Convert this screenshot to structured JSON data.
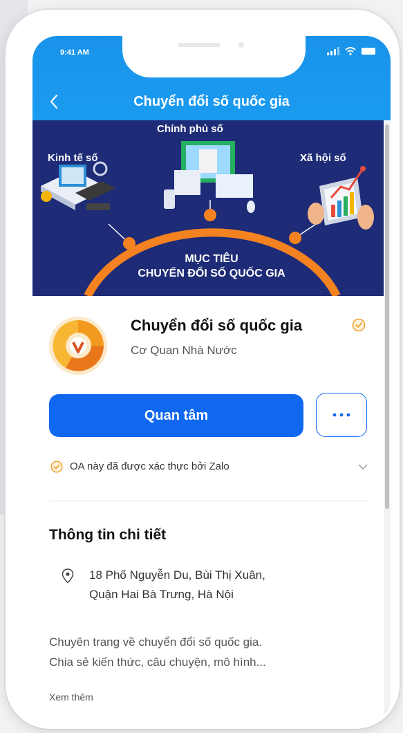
{
  "status_bar": {
    "time": "9:41 AM"
  },
  "header": {
    "title": "Chuyển đổi số quốc gia"
  },
  "banner": {
    "label_center": "Chính phủ số",
    "label_left": "Kinh tế số",
    "label_right": "Xã hội số",
    "goal_line1": "MỤC TIÊU",
    "goal_line2": "CHUYỂN ĐỔI SỐ QUỐC GIA"
  },
  "profile": {
    "name": "Chuyển đổi số quốc gia",
    "category": "Cơ Quan Nhà Nước"
  },
  "actions": {
    "follow_label": "Quan tâm",
    "more_label": "···"
  },
  "verification": {
    "text": "OA này đã được xác thực bởi Zalo"
  },
  "details": {
    "title": "Thông tin chi tiết",
    "address_line1": "18 Phố Nguyễn Du, Bùi Thị Xuân,",
    "address_line2": "Quận Hai Bà Trưng, Hà Nội",
    "description_line1": "Chuyên trang về chuyển đổi số quốc gia.",
    "description_line2": "Chia sẻ kiến thức, câu chuyện, mô hình...",
    "see_more": "Xem thêm"
  },
  "colors": {
    "header_blue": "#1a9bf0",
    "banner_navy": "#1e2b77",
    "button_blue": "#1068f0",
    "verified_orange": "#f0a030"
  }
}
